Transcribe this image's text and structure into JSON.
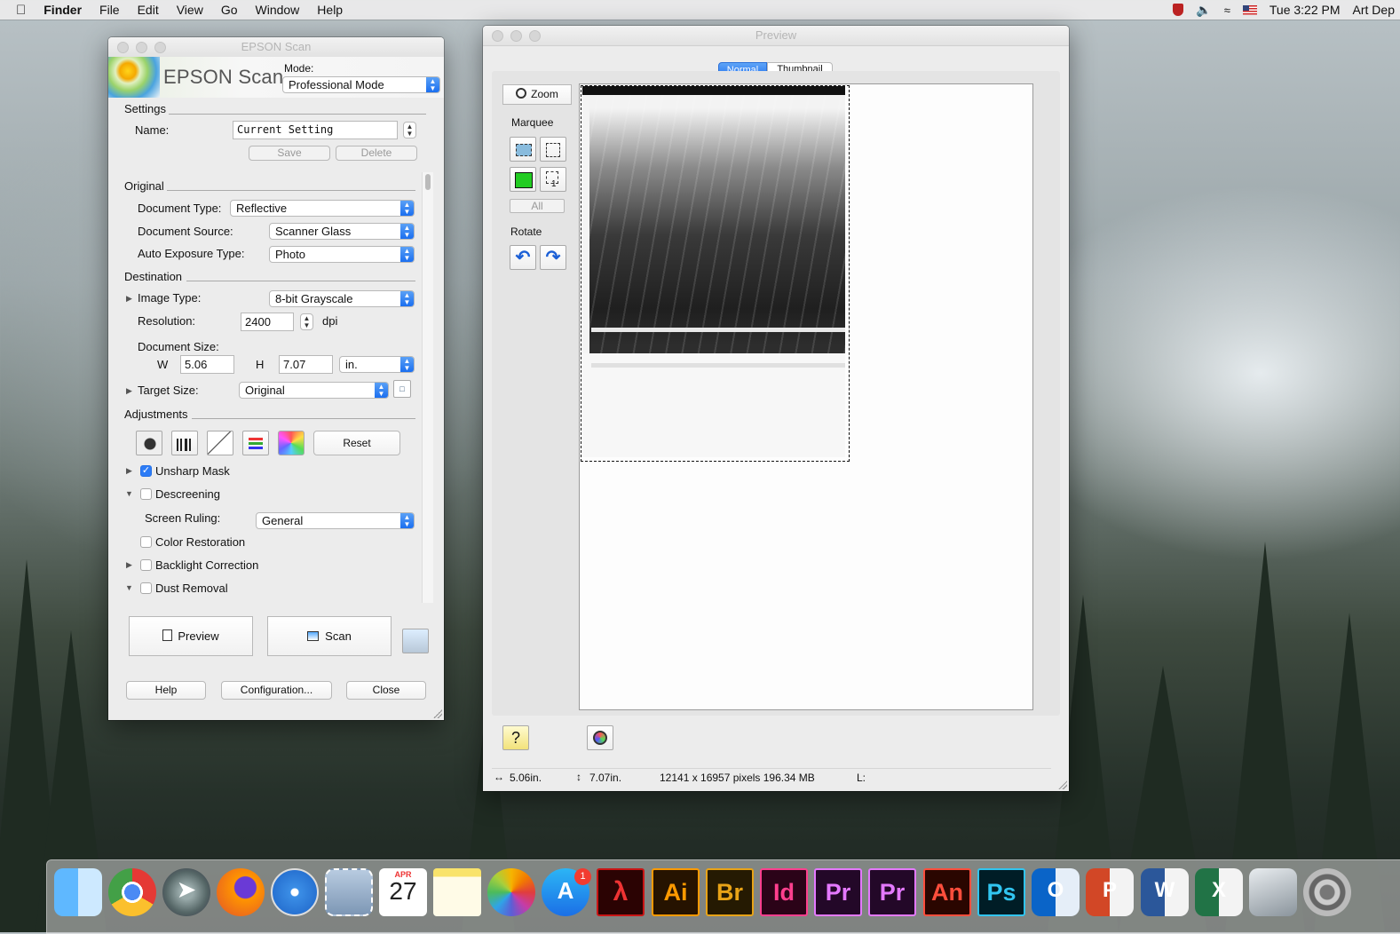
{
  "menubar": {
    "app": "Finder",
    "items": [
      "File",
      "Edit",
      "View",
      "Go",
      "Window",
      "Help"
    ],
    "clock": "Tue 3:22 PM",
    "user": "Art Dep"
  },
  "epson": {
    "title": "EPSON Scan",
    "brand": "EPSON Scan",
    "mode_label": "Mode:",
    "mode_value": "Professional Mode",
    "settings": {
      "header": "Settings",
      "name_label": "Name:",
      "name_value": "Current Setting",
      "save": "Save",
      "delete": "Delete"
    },
    "original": {
      "header": "Original",
      "doc_type_label": "Document Type:",
      "doc_type_value": "Reflective",
      "doc_source_label": "Document Source:",
      "doc_source_value": "Scanner Glass",
      "exposure_label": "Auto Exposure Type:",
      "exposure_value": "Photo"
    },
    "destination": {
      "header": "Destination",
      "image_type_label": "Image Type:",
      "image_type_value": "8-bit Grayscale",
      "resolution_label": "Resolution:",
      "resolution_value": "2400",
      "resolution_unit": "dpi",
      "doc_size_label": "Document Size:",
      "w_label": "W",
      "w_value": "5.06",
      "h_label": "H",
      "h_value": "7.07",
      "unit_value": "in.",
      "target_label": "Target Size:",
      "target_value": "Original"
    },
    "adjustments": {
      "header": "Adjustments",
      "reset": "Reset",
      "unsharp": "Unsharp Mask",
      "descreening": "Descreening",
      "screen_ruling_label": "Screen Ruling:",
      "screen_ruling_value": "General",
      "color_restoration": "Color Restoration",
      "backlight": "Backlight Correction",
      "dust": "Dust Removal"
    },
    "preview_btn": "Preview",
    "scan_btn": "Scan",
    "help_btn": "Help",
    "config_btn": "Configuration...",
    "close_btn": "Close"
  },
  "preview": {
    "title": "Preview",
    "tab_normal": "Normal",
    "tab_thumbnail": "Thumbnail",
    "zoom": "Zoom",
    "marquee": "Marquee",
    "all": "All",
    "rotate": "Rotate",
    "marquee_number": "1",
    "status_w": "5.06in.",
    "status_h": "7.07in.",
    "status_px": "12141 x 16957 pixels 196.34 MB",
    "status_l": "L:"
  },
  "dock": {
    "calendar_month": "APR",
    "calendar_day": "27",
    "appstore_badge": "1",
    "ai": "Ai",
    "br": "Br",
    "id": "Id",
    "pr1": "Pr",
    "pr2": "Pr",
    "an": "An",
    "ps": "Ps"
  }
}
